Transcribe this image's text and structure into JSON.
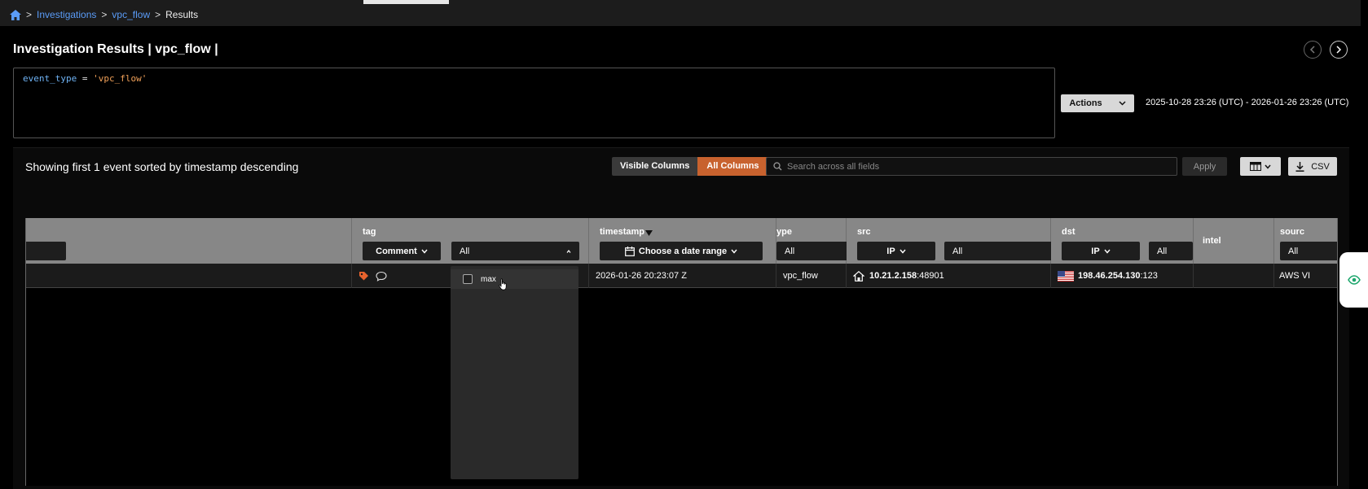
{
  "breadcrumb": {
    "items": [
      "Investigations",
      "vpc_flow"
    ],
    "current": "Results",
    "sep": ">"
  },
  "page": {
    "title": "Investigation Results | vpc_flow |"
  },
  "query": {
    "key": "event_type",
    "op": "=",
    "value": "'vpc_flow'"
  },
  "actions": {
    "label": "Actions",
    "date_range": "2025-10-28 23:26 (UTC) - 2026-01-26 23:26 (UTC)"
  },
  "results": {
    "showing": "Showing first 1 event sorted by timestamp descending",
    "visible_columns": "Visible Columns",
    "all_columns": "All Columns",
    "search_placeholder": "Search across all fields",
    "apply": "Apply",
    "csv": "CSV"
  },
  "columns": {
    "tag": {
      "label": "tag",
      "filter_btn": "Comment",
      "select_value": "All"
    },
    "timestamp": {
      "label": "timestamp",
      "filter_btn": "Choose a date range"
    },
    "type": {
      "label": "ype",
      "select_value": "All"
    },
    "src": {
      "label": "src",
      "filter_btn": "IP",
      "select_value": "All"
    },
    "dst": {
      "label": "dst",
      "filter_btn": "IP",
      "select_value": "All"
    },
    "intel": {
      "label": "intel"
    },
    "source": {
      "label": "sourc",
      "select_value": "All"
    }
  },
  "row": {
    "timestamp": "2026-01-26 20:23:07 Z",
    "type": "vpc_flow",
    "src_ip": "10.21.2.158",
    "src_port": ":48901",
    "dst_ip": "198.46.254.130",
    "dst_port": ":123",
    "source": "AWS VI"
  },
  "tag_dropdown": {
    "options": [
      "max"
    ]
  },
  "colors": {
    "accent": "#c8622e",
    "link": "#5a9cf8"
  }
}
